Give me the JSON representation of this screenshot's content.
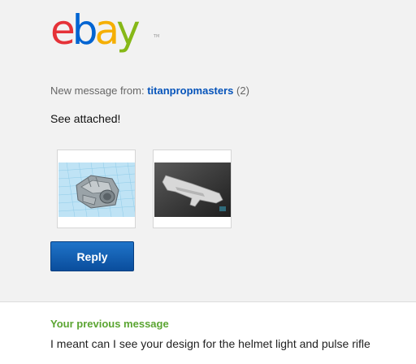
{
  "logo": {
    "e": "e",
    "b": "b",
    "a": "a",
    "y": "y",
    "tm": "TM"
  },
  "header": {
    "from_prefix": "New message from:",
    "username": "titanpropmasters",
    "feedback_count": "(2)"
  },
  "message": {
    "body": "See attached!"
  },
  "attachments": [
    {
      "name": "helmet-light-3d-model-thumbnail"
    },
    {
      "name": "pulse-rifle-photo-thumbnail"
    }
  ],
  "actions": {
    "reply_label": "Reply"
  },
  "previous": {
    "label": "Your previous message",
    "text": "I meant can I see your design for the helmet light and pulse rifle"
  },
  "colors": {
    "ebay_red": "#e53238",
    "ebay_blue": "#0064d2",
    "ebay_yellow": "#f5af02",
    "ebay_green": "#86b817",
    "link_blue": "#0654ba",
    "button_blue": "#0a4d9c",
    "prev_label_green": "#5ba532"
  }
}
